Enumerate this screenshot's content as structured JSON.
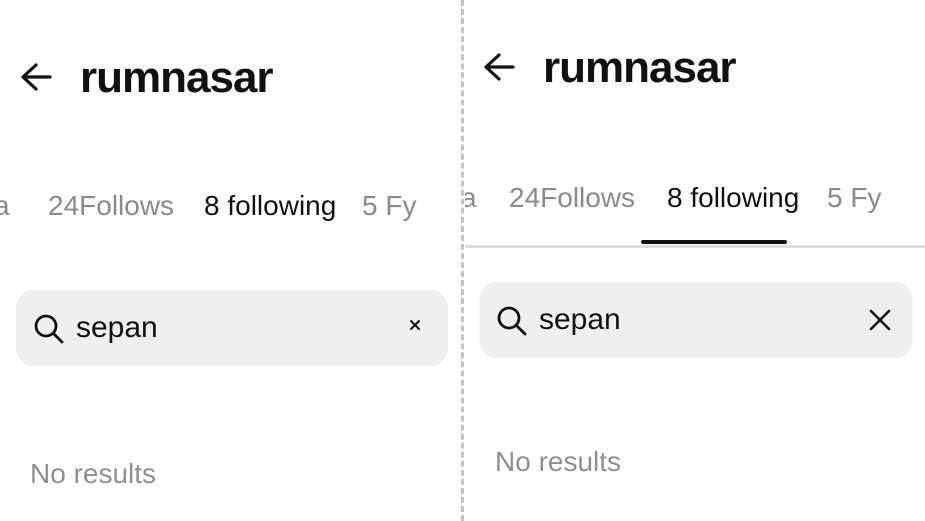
{
  "left_panel": {
    "title": "rumnasar",
    "tabs": [
      {
        "label": "a"
      },
      {
        "label": "24Follows"
      },
      {
        "label": "8 following"
      },
      {
        "label": "5 Fy"
      }
    ],
    "active_tab": 2,
    "search": {
      "value": "sepan"
    },
    "empty_text": "No results"
  },
  "right_panel": {
    "title": "rumnasar",
    "tabs": [
      {
        "label": "a"
      },
      {
        "label": "24Follows"
      },
      {
        "label": "8 following"
      },
      {
        "label": "5 Fy"
      }
    ],
    "active_tab": 2,
    "search": {
      "value": "sepan"
    },
    "empty_text": "No results"
  },
  "icons": {
    "back": "arrow-left-icon",
    "search": "search-icon",
    "clear": "close-icon"
  },
  "colors": {
    "text": "#111111",
    "muted": "#8a8a8a",
    "search_bg": "#efefef",
    "divider": "#c4c4c4"
  }
}
